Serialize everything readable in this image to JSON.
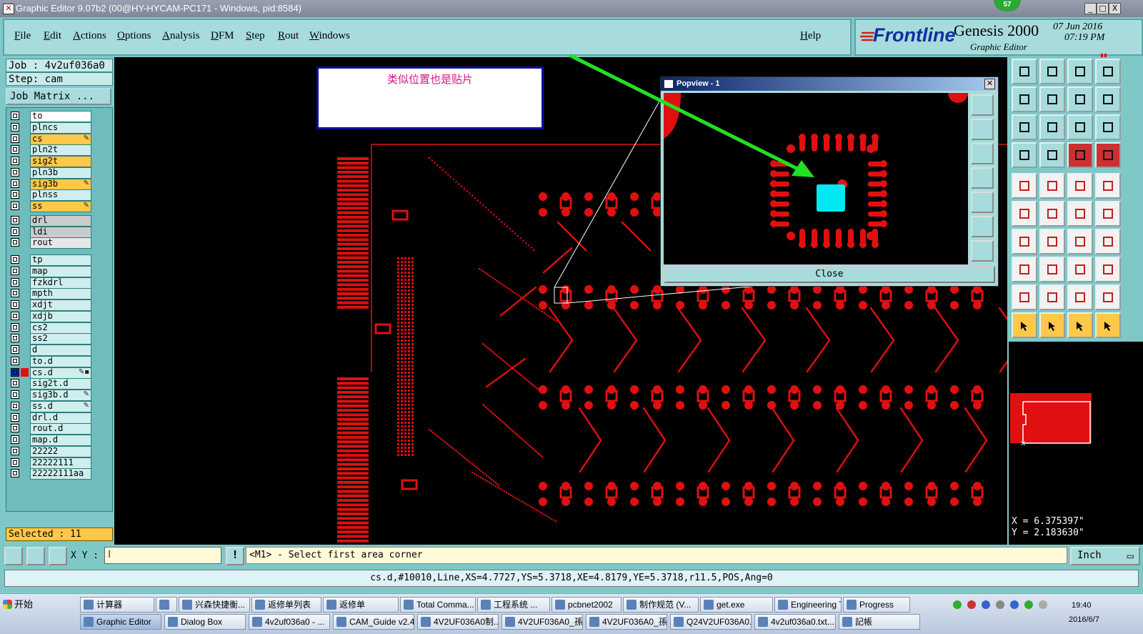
{
  "window": {
    "title": "Graphic Editor 9.07b2 (00@HY-HYCAM-PC171 - Windows, pid:8584)",
    "controls": [
      "_",
      "□",
      "X"
    ],
    "notification_count": "57"
  },
  "menu": {
    "items": [
      "File",
      "Edit",
      "Actions",
      "Options",
      "Analysis",
      "DFM",
      "Step",
      "Rout",
      "Windows"
    ],
    "help": "Help"
  },
  "brand": {
    "logo": "Frontline",
    "product": "Genesis 2000",
    "subtitle": "Graphic Editor",
    "date": "07 Jun 2016",
    "time": "07:19 PM"
  },
  "job": {
    "job_label": "Job : 4v2uf036a0",
    "step_label": "Step: cam",
    "job_matrix_button": "Job Matrix ..."
  },
  "layers": [
    {
      "name": "to",
      "style": "w"
    },
    {
      "name": "plncs",
      "style": ""
    },
    {
      "name": "cs",
      "style": "o",
      "mark": "✎"
    },
    {
      "name": "pln2t",
      "style": ""
    },
    {
      "name": "sig2t",
      "style": "o"
    },
    {
      "name": "pln3b",
      "style": ""
    },
    {
      "name": "sig3b",
      "style": "o",
      "mark": "✎"
    },
    {
      "name": "plnss",
      "style": ""
    },
    {
      "name": "ss",
      "style": "o",
      "mark": "✎"
    },
    {
      "name": "drl",
      "style": "g"
    },
    {
      "name": "ldi",
      "style": "g"
    },
    {
      "name": "rout",
      "style": "lt"
    },
    {
      "name": "tp",
      "style": ""
    },
    {
      "name": "map",
      "style": ""
    },
    {
      "name": "fzkdrl",
      "style": ""
    },
    {
      "name": "mpth",
      "style": ""
    },
    {
      "name": "xdjt",
      "style": ""
    },
    {
      "name": "xdjb",
      "style": ""
    },
    {
      "name": "cs2",
      "style": ""
    },
    {
      "name": "ss2",
      "style": ""
    },
    {
      "name": "d",
      "style": ""
    },
    {
      "name": "to.d",
      "style": ""
    },
    {
      "name": "cs.d",
      "style": "",
      "mark": "✎▪",
      "active": true
    },
    {
      "name": "sig2t.d",
      "style": ""
    },
    {
      "name": "sig3b.d",
      "style": "",
      "mark": "✎"
    },
    {
      "name": "ss.d",
      "style": "",
      "mark": "✎"
    },
    {
      "name": "drl.d",
      "style": ""
    },
    {
      "name": "rout.d",
      "style": ""
    },
    {
      "name": "map.d",
      "style": ""
    },
    {
      "name": "22222",
      "style": ""
    },
    {
      "name": "22222111",
      "style": ""
    },
    {
      "name": "22222111aa",
      "style": ""
    }
  ],
  "selected_label": "Selected : 11",
  "note": {
    "text": "类似位置也是贴片"
  },
  "popview": {
    "title": "Popview - 1",
    "close_label": "Close"
  },
  "coords": {
    "x": "X = 6.375397\"",
    "y": "Y = 2.183630\""
  },
  "command": {
    "xy_label": "X Y :",
    "prompt": "<M1> - Select first area corner",
    "unit": "Inch"
  },
  "status": "cs.d,#10010,Line,XS=4.7727,YS=5.3718,XE=4.8179,YE=5.3718,r11.5,POS,Ang=0",
  "taskbar": {
    "start": "开始",
    "row1": [
      "计算器",
      "",
      "兴森快捷衡...",
      "返修单列表",
      "返修单",
      "Total Comma...",
      "工程系统 ...",
      "pcbnet2002",
      "制作规范 (V...",
      "get.exe",
      "Engineering T...",
      "Progress"
    ],
    "row2": [
      "Graphic Editor",
      "Dialog Box",
      "4v2uf036a0 - ...",
      "CAM_Guide v2.40",
      "4V2UF036A0制...",
      "4V2UF036A0_孫...",
      "4V2UF036A0_孫...",
      "Q24V2UF036A0...",
      "4v2uf036a0.txt...",
      "記帳"
    ],
    "clock": "19:40",
    "date": "2016/6/7"
  },
  "colors": {
    "board_red": "#e01010",
    "accent_cyan": "#00e8f0",
    "arrow_green": "#22e022",
    "panel_teal": "#7fc8c8",
    "highlight_orange": "#ffc84a"
  }
}
